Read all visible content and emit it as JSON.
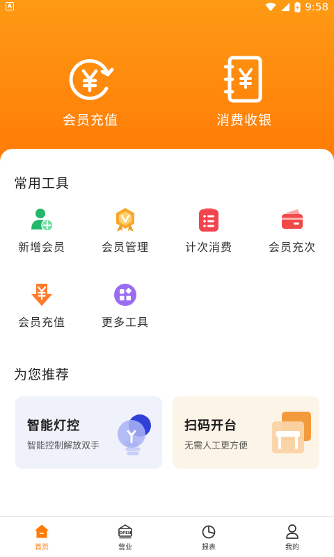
{
  "status_bar": {
    "time": "9:58",
    "app_badge": "A"
  },
  "hero": {
    "recharge_label": "会员充值",
    "checkout_label": "消费收银"
  },
  "tools": {
    "title": "常用工具",
    "items": [
      {
        "label": "新增会员",
        "icon": "add-member-icon"
      },
      {
        "label": "会员管理",
        "icon": "member-management-icon"
      },
      {
        "label": "计次消费",
        "icon": "count-consumption-icon"
      },
      {
        "label": "会员充次",
        "icon": "member-recharge-times-icon"
      },
      {
        "label": "会员充值",
        "icon": "member-recharge-icon"
      },
      {
        "label": "更多工具",
        "icon": "more-tools-icon"
      }
    ]
  },
  "recommend": {
    "title": "为您推荐",
    "cards": [
      {
        "title": "智能灯控",
        "subtitle": "智能控制解放双手",
        "icon": "smart-light-icon"
      },
      {
        "title": "扫码开台",
        "subtitle": "无需人工更方便",
        "icon": "scan-table-icon"
      }
    ]
  },
  "nav": {
    "items": [
      {
        "label": "首页",
        "icon": "home-icon",
        "active": true
      },
      {
        "label": "营业",
        "icon": "open-shop-icon"
      },
      {
        "label": "报表",
        "icon": "report-pie-icon"
      },
      {
        "label": "我的",
        "icon": "profile-icon"
      }
    ]
  },
  "colors": {
    "accent": "#ff7a06",
    "hero_top": "#ff9a14"
  }
}
